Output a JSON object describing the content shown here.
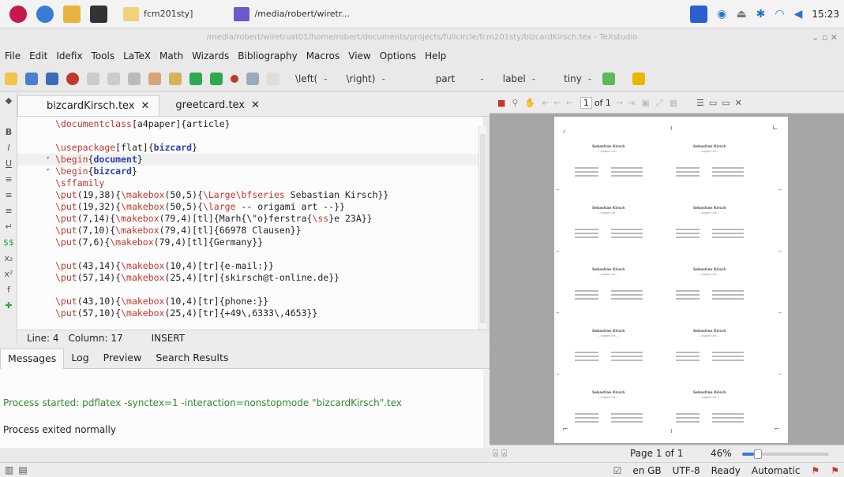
{
  "taskbar": {
    "tasks": [
      {
        "label": "fcm201sty]",
        "color": "#f1d27a"
      },
      {
        "label": "/media/robert/wiretr...",
        "color": "#6a5acd"
      }
    ],
    "clock": "15:23"
  },
  "window": {
    "title": "/media/robert/wiretrust01/home/robert/documents/projects/fullcircle/fcm201sty/bizcardKirsch.tex - TeXstudio"
  },
  "menu": [
    "File",
    "Edit",
    "Idefix",
    "Tools",
    "LaTeX",
    "Math",
    "Wizards",
    "Bibliography",
    "Macros",
    "View",
    "Options",
    "Help"
  ],
  "toolbar": {
    "left_delim": "\\left(",
    "right_delim": "\\right)",
    "section": "part",
    "ref": "label",
    "size": "tiny"
  },
  "tabs": [
    {
      "label": "bizcardKirsch.tex",
      "close": "✕",
      "active": true
    },
    {
      "label": "greetcard.tex",
      "close": "✕",
      "active": false
    }
  ],
  "editor": {
    "lines": [
      {
        "text": "\\documentclass[a4paper]{article}",
        "hl": false
      },
      {
        "text": "",
        "hl": false
      },
      {
        "text": "\\usepackage[flat]{bizcard}",
        "hl": false
      },
      {
        "text": "\\begin{document}",
        "hl": true
      },
      {
        "text": "\\begin{bizcard}",
        "hl": false
      },
      {
        "text": "\\sffamily",
        "hl": false
      },
      {
        "text": "\\put(19,38){\\makebox(50,5){\\Large\\bfseries Sebastian Kirsch}}",
        "hl": false
      },
      {
        "text": "\\put(19,32){\\makebox(50,5){\\large -- origami art --}}",
        "hl": false
      },
      {
        "text": "\\put(7,14){\\makebox(79,4)[tl]{Marh{\\\"o}ferstra{\\ss}e 23A}}",
        "hl": false
      },
      {
        "text": "\\put(7,10){\\makebox(79,4)[tl]{66978 Clausen}}",
        "hl": false
      },
      {
        "text": "\\put(7,6){\\makebox(79,4)[tl]{Germany}}",
        "hl": false
      },
      {
        "text": "",
        "hl": false
      },
      {
        "text": "\\put(43,14){\\makebox(10,4)[tr]{e-mail:}}",
        "hl": false
      },
      {
        "text": "\\put(57,14){\\makebox(25,4)[tr]{skirsch@t-online.de}}",
        "hl": false
      },
      {
        "text": "",
        "hl": false
      },
      {
        "text": "\\put(43,10){\\makebox(10,4)[tr]{phone:}}",
        "hl": false
      },
      {
        "text": "\\put(57,10){\\makebox(25,4)[tr]{+49\\,6333\\,4653}}",
        "hl": false
      }
    ]
  },
  "status": {
    "line": "Line: 4",
    "column": "Column: 17",
    "mode": "INSERT"
  },
  "messages": {
    "tabs": [
      "Messages",
      "Log",
      "Preview",
      "Search Results"
    ],
    "close": "✕",
    "line1": "Process started: pdflatex -synctex=1 -interaction=nonstopmode \"bizcardKirsch\".tex",
    "line2": "Process exited normally"
  },
  "pdf": {
    "page_input": "1",
    "page_of": "of 1",
    "card_name": "Sebastian Kirsch",
    "card_sub": "-- origami art --",
    "page_info": "Page 1 of 1",
    "zoom": "46%",
    "zoom_level": 0.46
  },
  "bottom": {
    "lang": "en GB",
    "encoding": "UTF-8",
    "state": "Ready",
    "mode": "Automatic"
  },
  "colors": {
    "keyword": "#c0392b",
    "env": "#2d3fb0",
    "brace": "#8b1a1a",
    "plain": "#222222",
    "green": "#2e8b2e"
  }
}
